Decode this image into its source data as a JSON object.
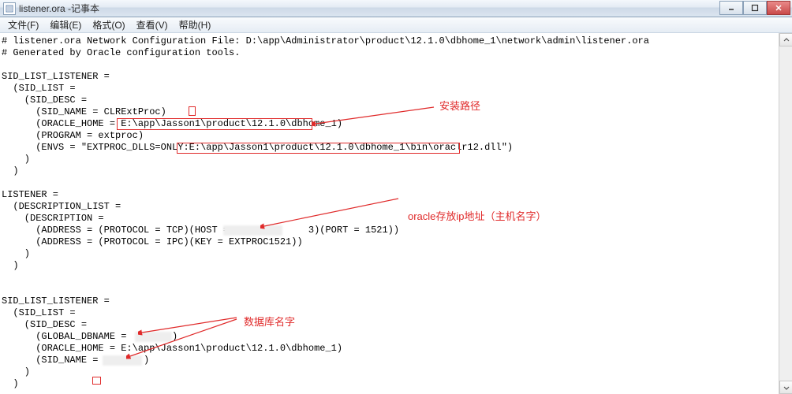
{
  "titlebar": {
    "filename": "listener.ora",
    "appname": "记事本"
  },
  "menubar": {
    "file": "文件(F)",
    "edit": "编辑(E)",
    "format": "格式(O)",
    "view": "查看(V)",
    "help": "帮助(H)"
  },
  "content_lines": [
    "# listener.ora Network Configuration File: D:\\app\\Administrator\\product\\12.1.0\\dbhome_1\\network\\admin\\listener.ora",
    "# Generated by Oracle configuration tools.",
    "",
    "SID_LIST_LISTENER =",
    "  (SID_LIST =",
    "    (SID_DESC =",
    "      (SID_NAME = CLRExtProc)",
    "      (ORACLE_HOME = E:\\app\\Jasson1\\product\\12.1.0\\dbhome_1)",
    "      (PROGRAM = extproc)",
    "      (ENVS = \"EXTPROC_DLLS=ONLY:E:\\app\\Jasson1\\product\\12.1.0\\dbhome_1\\bin\\oraclr12.dll\")",
    "    )",
    "  )",
    "",
    "LISTENER =",
    "  (DESCRIPTION_LIST =",
    "    (DESCRIPTION =",
    "      (ADDRESS = (PROTOCOL = TCP)(HOST =              3)(PORT = 1521))",
    "      (ADDRESS = (PROTOCOL = IPC)(KEY = EXTPROC1521))",
    "    )",
    "  )",
    "",
    "",
    "SID_LIST_LISTENER =",
    "  (SID_LIST =",
    "    (SID_DESC =",
    "      (GLOBAL_DBNAME =        )",
    "      (ORACLE_HOME = E:\\app\\Jasson1\\product\\12.1.0\\dbhome_1)",
    "      (SID_NAME =        )",
    "    )",
    "  )"
  ],
  "annotations": {
    "install_path": "安装路径",
    "ip_address": "oracle存放ip地址（主机名字）",
    "db_name": "数据库名字"
  }
}
